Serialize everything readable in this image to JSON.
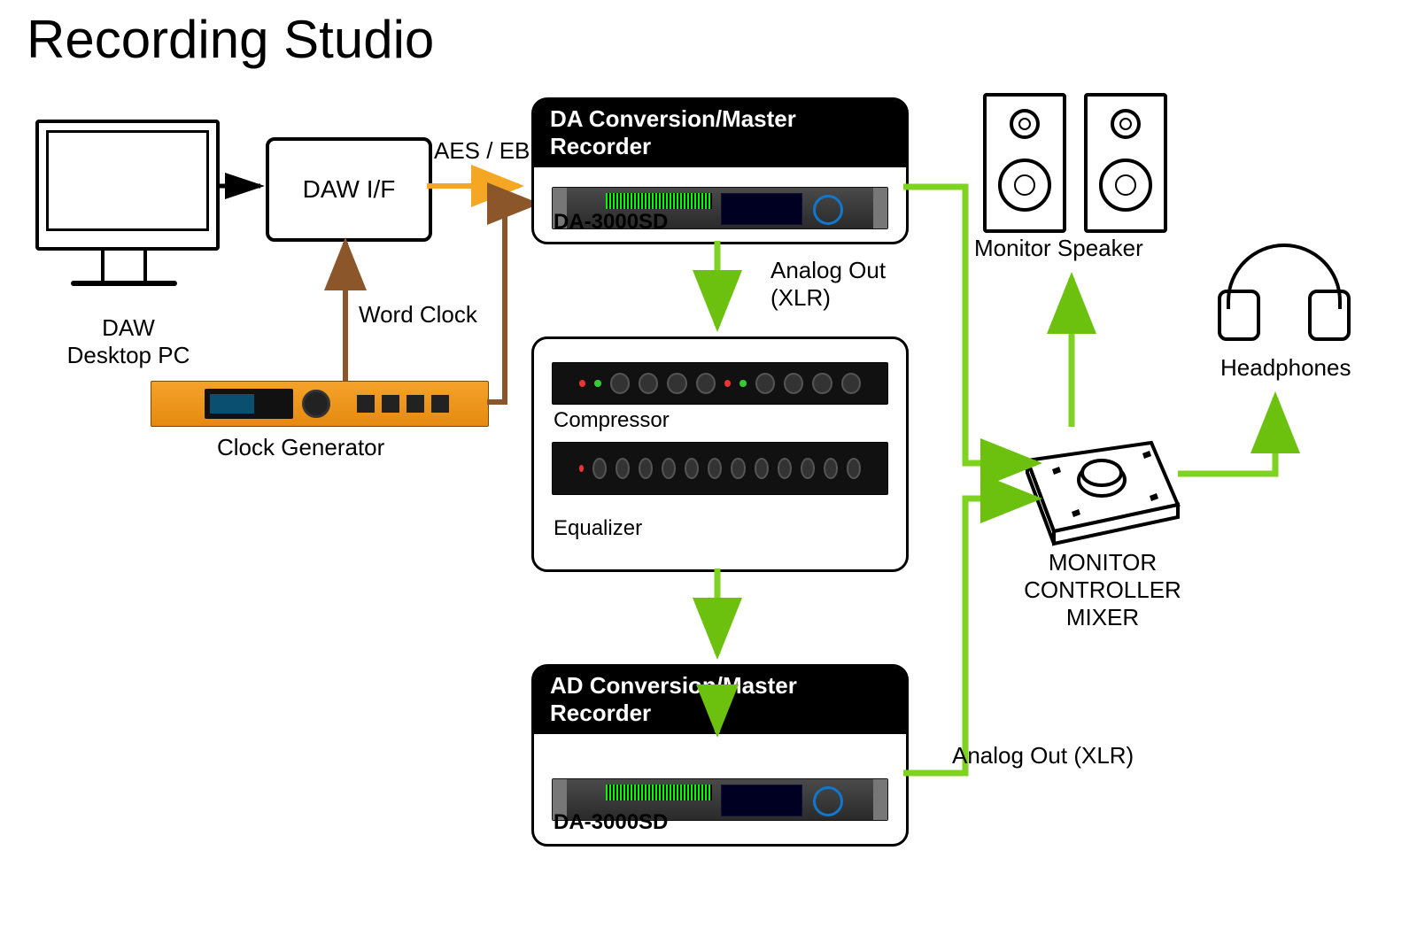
{
  "title": "Recording Studio",
  "nodes": {
    "daw_pc": "DAW\nDesktop PC",
    "daw_if": "DAW I/F",
    "clock_gen": "Clock Generator",
    "da_box_header": "DA Conversion/Master Recorder",
    "da_model": "DA-3000SD",
    "compressor": "Compressor",
    "equalizer": "Equalizer",
    "ad_box_header": "AD Conversion/Master Recorder",
    "ad_model": "DA-3000SD",
    "monitor_speaker": "Monitor Speaker",
    "headphones": "Headphones",
    "monitor_controller": "MONITOR CONTROLLER\nMIXER"
  },
  "edges": {
    "aes_ebu": "AES / EBU",
    "word_clock": "Word Clock",
    "analog_out_1": "Analog Out\n(XLR)",
    "analog_out_2": "Analog Out (XLR)"
  },
  "colors": {
    "aes": "#f5a623",
    "clock": "#8b572a",
    "analog": "#7ed321",
    "analog_stroke": "#6cc10f"
  }
}
